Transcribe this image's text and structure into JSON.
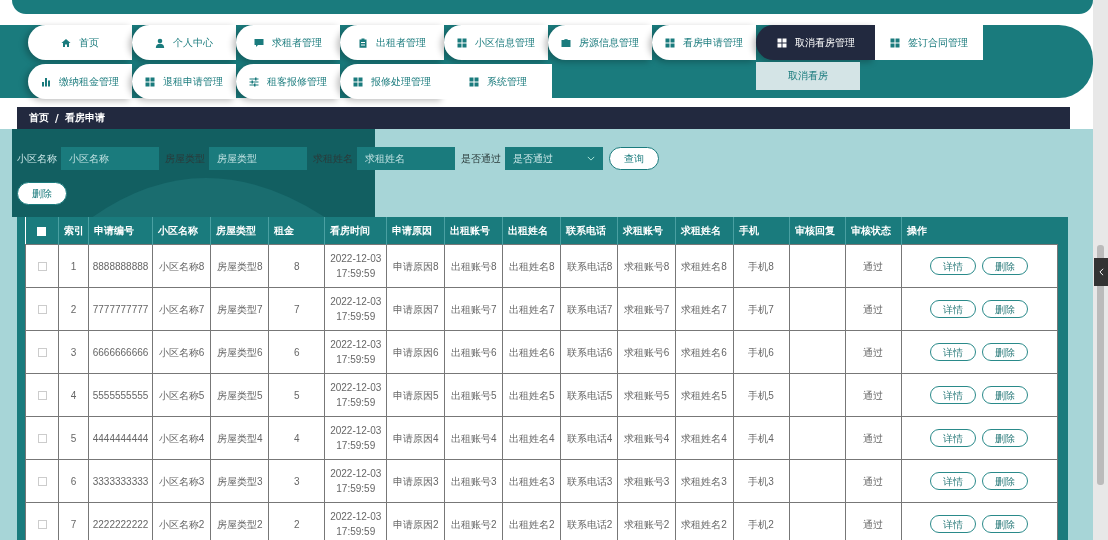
{
  "nav": {
    "rows": [
      [
        {
          "label": "首页",
          "kind": "home",
          "selected": false
        },
        {
          "label": "个人中心",
          "kind": "person",
          "selected": false
        },
        {
          "label": "求租者管理",
          "kind": "chat",
          "selected": false
        },
        {
          "label": "出租者管理",
          "kind": "clipboard",
          "selected": false
        },
        {
          "label": "小区信息管理",
          "kind": "grid",
          "selected": false
        },
        {
          "label": "房源信息管理",
          "kind": "briefcase",
          "selected": false
        },
        {
          "label": "看房申请管理",
          "kind": "grid",
          "selected": false
        },
        {
          "label": "取消看房管理",
          "kind": "grid",
          "selected": true,
          "submenu": [
            "取消看房"
          ]
        },
        {
          "label": "签订合同管理",
          "kind": "grid",
          "selected": false
        }
      ],
      [
        {
          "label": "缴纳租金管理",
          "kind": "chart",
          "selected": false
        },
        {
          "label": "退租申请管理",
          "kind": "grid",
          "selected": false
        },
        {
          "label": "租客报修管理",
          "kind": "sliders",
          "selected": false
        },
        {
          "label": "报修处理管理",
          "kind": "grid",
          "selected": false
        },
        {
          "label": "系统管理",
          "kind": "grid",
          "selected": false
        }
      ]
    ]
  },
  "breadcrumb": {
    "items": [
      "首页",
      "看房申请"
    ],
    "separator": "/"
  },
  "search": {
    "fields": [
      {
        "label": "小区名称",
        "placeholder": "小区名称",
        "kind": "input"
      },
      {
        "label": "房屋类型",
        "placeholder": "房屋类型",
        "kind": "input"
      },
      {
        "label": "求租姓名",
        "placeholder": "求租姓名",
        "kind": "input"
      },
      {
        "label": "是否通过",
        "placeholder": "是否通过",
        "kind": "select"
      }
    ],
    "button": "查询"
  },
  "delete_button": "删除",
  "table": {
    "select_all_checked": false,
    "columns": [
      "索引",
      "申请编号",
      "小区名称",
      "房屋类型",
      "租金",
      "看房时间",
      "申请原因",
      "出租账号",
      "出租姓名",
      "联系电话",
      "求租账号",
      "求租姓名",
      "手机",
      "审核回复",
      "审核状态",
      "操作"
    ],
    "rows": [
      {
        "checked": false,
        "cells": [
          "1",
          "8888888888",
          "小区名称8",
          "房屋类型8",
          "8",
          "2022-12-03 17:59:59",
          "申请原因8",
          "出租账号8",
          "出租姓名8",
          "联系电话8",
          "求租账号8",
          "求租姓名8",
          "手机8",
          "",
          "通过"
        ],
        "actions": [
          "详情",
          "删除"
        ]
      },
      {
        "checked": false,
        "cells": [
          "2",
          "7777777777",
          "小区名称7",
          "房屋类型7",
          "7",
          "2022-12-03 17:59:59",
          "申请原因7",
          "出租账号7",
          "出租姓名7",
          "联系电话7",
          "求租账号7",
          "求租姓名7",
          "手机7",
          "",
          "通过"
        ],
        "actions": [
          "详情",
          "删除"
        ]
      },
      {
        "checked": false,
        "cells": [
          "3",
          "6666666666",
          "小区名称6",
          "房屋类型6",
          "6",
          "2022-12-03 17:59:59",
          "申请原因6",
          "出租账号6",
          "出租姓名6",
          "联系电话6",
          "求租账号6",
          "求租姓名6",
          "手机6",
          "",
          "通过"
        ],
        "actions": [
          "详情",
          "删除"
        ]
      },
      {
        "checked": false,
        "cells": [
          "4",
          "5555555555",
          "小区名称5",
          "房屋类型5",
          "5",
          "2022-12-03 17:59:59",
          "申请原因5",
          "出租账号5",
          "出租姓名5",
          "联系电话5",
          "求租账号5",
          "求租姓名5",
          "手机5",
          "",
          "通过"
        ],
        "actions": [
          "详情",
          "删除"
        ]
      },
      {
        "checked": false,
        "cells": [
          "5",
          "4444444444",
          "小区名称4",
          "房屋类型4",
          "4",
          "2022-12-03 17:59:59",
          "申请原因4",
          "出租账号4",
          "出租姓名4",
          "联系电话4",
          "求租账号4",
          "求租姓名4",
          "手机4",
          "",
          "通过"
        ],
        "actions": [
          "详情",
          "删除"
        ]
      },
      {
        "checked": false,
        "cells": [
          "6",
          "3333333333",
          "小区名称3",
          "房屋类型3",
          "3",
          "2022-12-03 17:59:59",
          "申请原因3",
          "出租账号3",
          "出租姓名3",
          "联系电话3",
          "求租账号3",
          "求租姓名3",
          "手机3",
          "",
          "通过"
        ],
        "actions": [
          "详情",
          "删除"
        ]
      },
      {
        "checked": false,
        "cells": [
          "7",
          "2222222222",
          "小区名称2",
          "房屋类型2",
          "2",
          "2022-12-03 17:59:59",
          "申请原因2",
          "出租账号2",
          "出租姓名2",
          "联系电话2",
          "求租账号2",
          "求租姓名2",
          "手机2",
          "",
          "通过"
        ],
        "actions": [
          "详情",
          "删除"
        ]
      }
    ]
  }
}
